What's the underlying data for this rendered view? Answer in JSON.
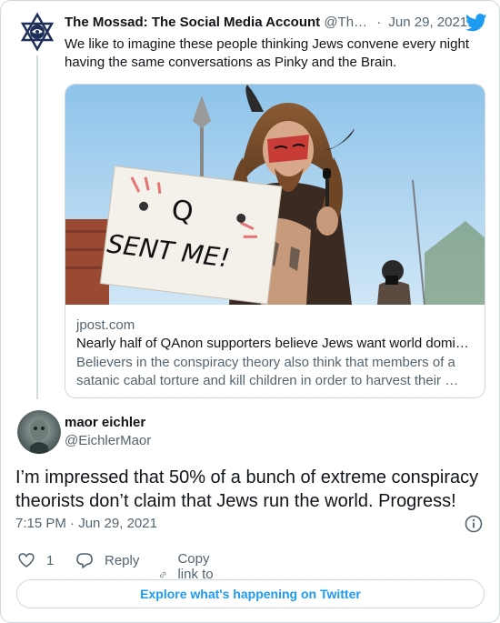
{
  "quoted_tweet": {
    "display_name": "The Mossad: The Social Media Account",
    "handle": "@Th…",
    "separator": "·",
    "date": "Jun 29, 2021",
    "text": "We like to imagine these people thinking Jews convene every night having the same conversations as Pinky and the Brain.",
    "link_card": {
      "image_sign_text": "Q SENT ME!",
      "domain": "jpost.com",
      "title": "Nearly half of QAnon supporters believe Jews want world domi…",
      "description": "Believers in the conspiracy theory also think that members of a satanic cabal torture and kill children in order to harvest their …"
    }
  },
  "main_tweet": {
    "display_name": "maor eichler",
    "handle": "@EichlerMaor",
    "text": "I’m impressed that 50% of a bunch of extreme conspiracy theorists don’t claim that Jews run the world. Progress!",
    "time": "7:15 PM · Jun 29, 2021"
  },
  "actions": {
    "like_count": "1",
    "reply_label": "Reply",
    "copy_link_label": "Copy link to Tweet"
  },
  "footer": {
    "explore_label": "Explore what's happening on Twitter"
  },
  "colors": {
    "twitter_blue": "#1d9bf0",
    "text_primary": "#0f1419",
    "text_secondary": "#536471",
    "border": "#cfd9de"
  },
  "icons": [
    "twitter-bird-icon",
    "info-icon",
    "heart-icon",
    "reply-icon",
    "link-icon"
  ]
}
